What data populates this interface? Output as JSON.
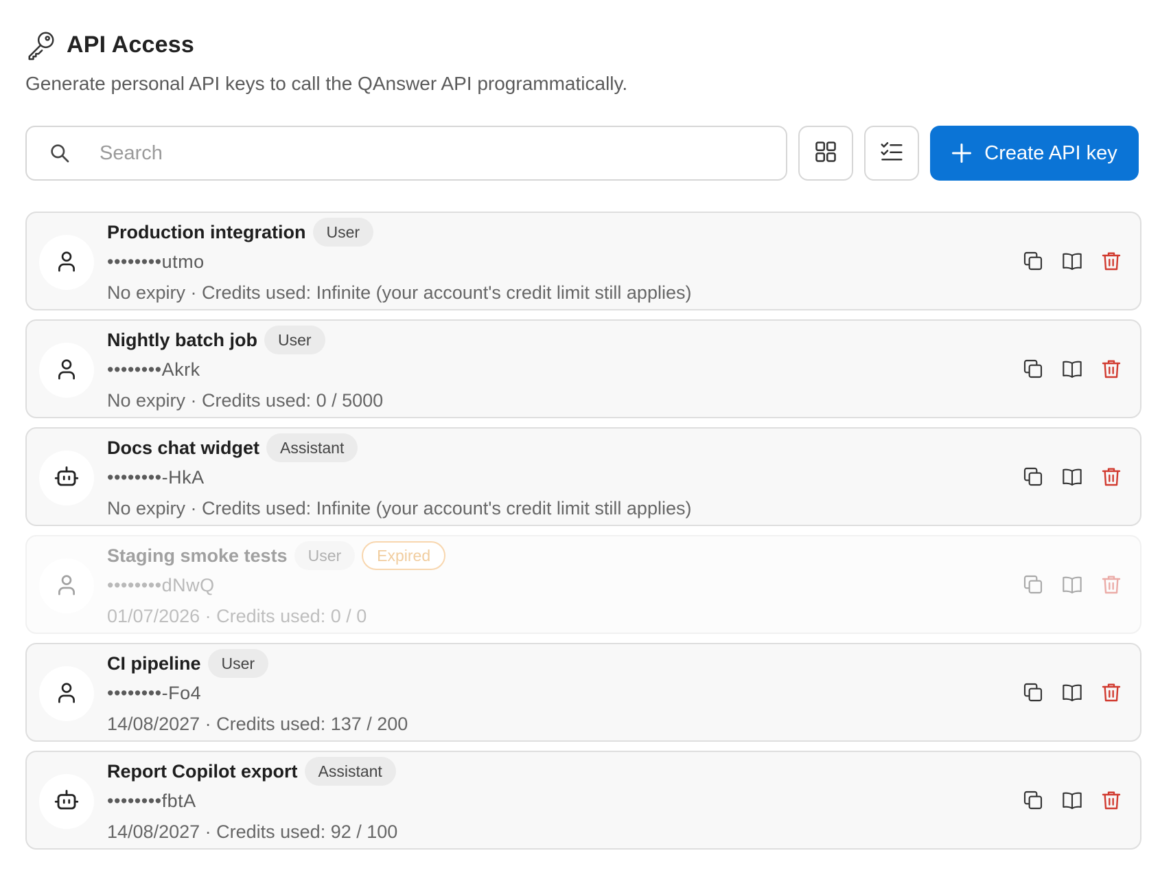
{
  "header": {
    "title": "API Access",
    "subtitle": "Generate personal API keys to call the QAnswer API programmatically."
  },
  "toolbar": {
    "search_placeholder": "Search",
    "create_label": "Create API key"
  },
  "colors": {
    "primary": "#0b74d6",
    "danger": "#d13a2f",
    "expired": "#e08a1c"
  },
  "keys": [
    {
      "name": "Production integration",
      "role": "User",
      "icon": "user-icon",
      "masked": "••••••••utmo",
      "meta": "No expiry · Credits used: Infinite (your account's credit limit still applies)",
      "expired": false
    },
    {
      "name": "Nightly batch job",
      "role": "User",
      "icon": "user-icon",
      "masked": "••••••••Akrk",
      "meta": "No expiry · Credits used: 0 / 5000",
      "expired": false
    },
    {
      "name": "Docs chat widget",
      "role": "Assistant",
      "icon": "robot-icon",
      "masked": "••••••••-HkA",
      "meta": "No expiry · Credits used: Infinite (your account's credit limit still applies)",
      "expired": false
    },
    {
      "name": "Staging smoke tests",
      "role": "User",
      "icon": "user-icon",
      "masked": "••••••••dNwQ",
      "meta": "01/07/2026 · Credits used: 0 / 0",
      "expired": true,
      "status": "Expired"
    },
    {
      "name": "CI pipeline",
      "role": "User",
      "icon": "user-icon",
      "masked": "••••••••-Fo4",
      "meta": "14/08/2027 · Credits used: 137 / 200",
      "expired": false
    },
    {
      "name": "Report Copilot export",
      "role": "Assistant",
      "icon": "robot-icon",
      "masked": "••••••••fbtA",
      "meta": "14/08/2027 · Credits used: 92 / 100",
      "expired": false
    }
  ]
}
